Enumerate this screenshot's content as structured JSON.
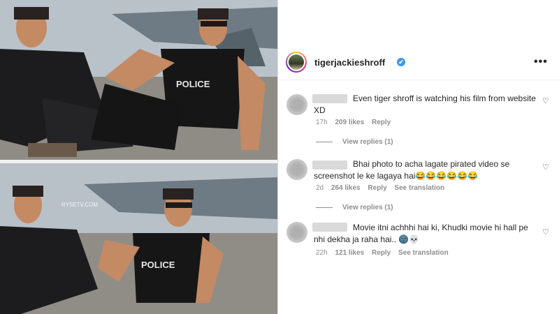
{
  "post": {
    "photo_top_text": "POLICE",
    "photo_bottom_text": "POLICE",
    "photo_bottom_watermark": "RYSETV.COM"
  },
  "header": {
    "username": "tigerjackieshroff",
    "verified_icon": "✔",
    "more_label": "•••"
  },
  "comments": [
    {
      "text": "Even tiger shroff is watching his film from website XD",
      "time": "17h",
      "likes": "209 likes",
      "reply": "Reply",
      "translate": "",
      "view_replies": "View replies (1)"
    },
    {
      "text": "Bhai photo to acha lagate pirated video se screenshot le ke lagaya hai😂😂😂😂😂😂",
      "time": "2d",
      "likes": "264 likes",
      "reply": "Reply",
      "translate": "See translation",
      "view_replies": "View replies (1)"
    },
    {
      "text": "Movie itni achhhi hai ki, Khudki movie hi hall pe nhi dekha ja raha hai.. 🌚💀",
      "time": "22h",
      "likes": "121 likes",
      "reply": "Reply",
      "translate": "See translation",
      "view_replies": ""
    }
  ],
  "icons": {
    "heart": "♡"
  },
  "colors": {
    "verified": "#3897f0",
    "muted": "#8e8e8e"
  }
}
